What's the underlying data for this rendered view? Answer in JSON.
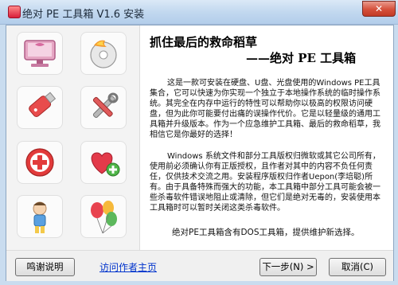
{
  "window": {
    "title": "绝对 PE 工具箱 V1.6 安装",
    "close_symbol": "✕",
    "app_icon": "toolbox-app-icon"
  },
  "sidebar_icons": [
    "monitor-icon",
    "disc-burn-icon",
    "usb-drive-icon",
    "tools-icon",
    "first-aid-icon",
    "heart-plus-icon",
    "child-icon",
    "balloons-icon"
  ],
  "content": {
    "heading_line1": "抓住最后的救命稻草",
    "heading_line2": "——绝对 PE 工具箱",
    "paragraph1": "这是一款可安装在硬盘、U盘、光盘使用的Windows PE工具集合，它可以快速为你实现一个独立于本地操作系统的临时操作系统。其完全在内存中运行的特性可以帮助你以极高的权限访问硬盘，但为此你可能要付出痛的误操作代价。它是以轻量级的通用工具箱并升级版本。作为一个应急维护工具箱、最后的救命稻草，我相信它是你最好的选择！",
    "paragraph2": "Windows 系统文件和部分工具版权归微软或其它公司所有，使用前必须确认你有正版授权，且作者对其中的内容不负任何责任，仅供技术交流之用。安装程序版权归作者Uepon(李培聪)所有。由于具备特殊而强大的功能，本工具箱中部分工具可能会被一些杀毒软件错误地阻止或清除，但它们是绝对无毒的，安装使用本工具箱时可以暂时关闭这类杀毒软件。",
    "paragraph3": "绝对PE工具箱含有DOS工具箱，提供维护新选择。"
  },
  "buttons": {
    "thanks": "鸣谢说明",
    "visit_link": "访问作者主页",
    "next": "下一步(N) >",
    "cancel": "取消(C)"
  }
}
